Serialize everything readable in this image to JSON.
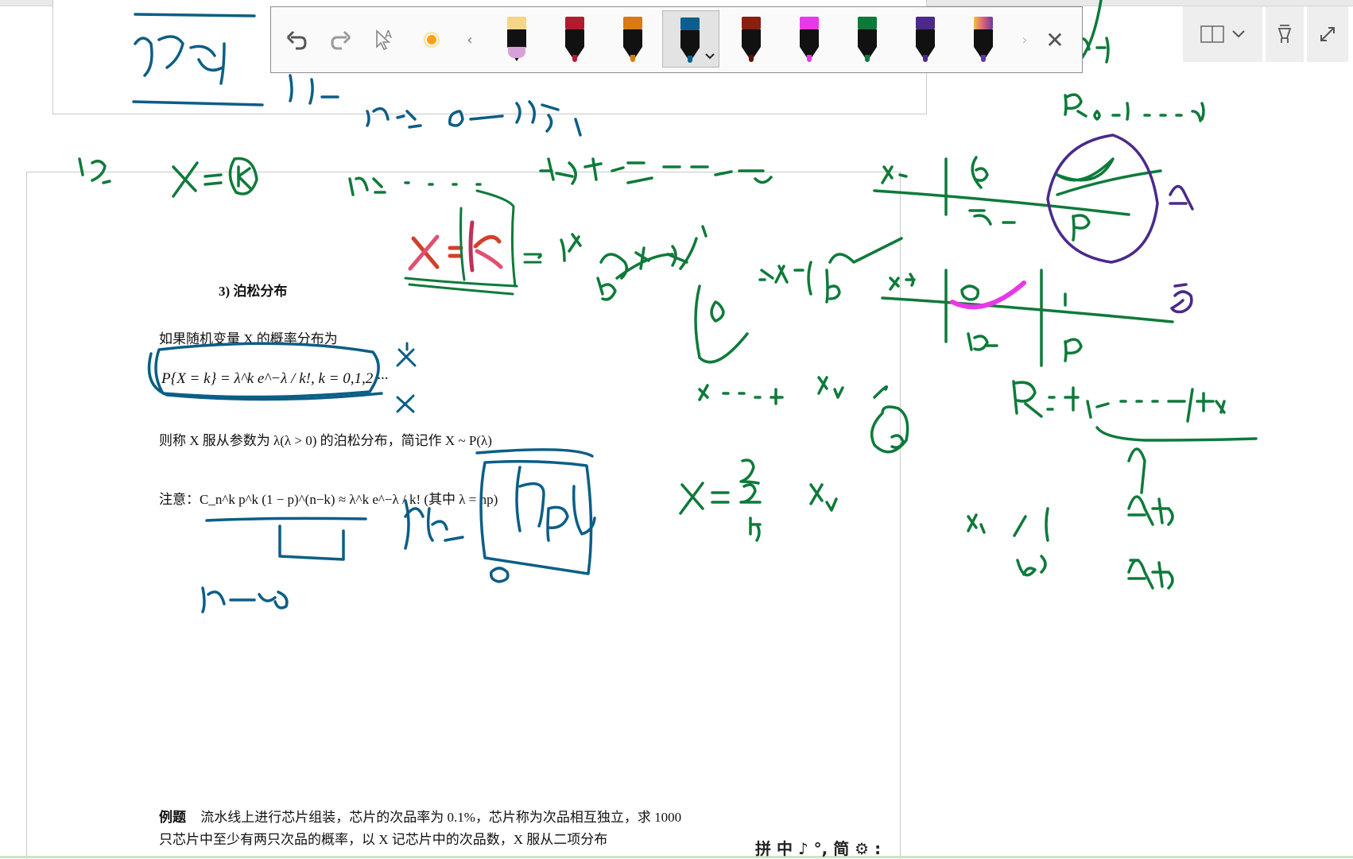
{
  "document": {
    "section_heading": "3)    泊松分布",
    "definition_intro": "如果随机变量 X 的概率分布为",
    "pmf_formula": "P{X = k} = λ^k e^−λ / k!, k = 0,1,2,···",
    "poisson_def": "则称 X 服从参数为 λ(λ > 0) 的泊松分布，简记作 X ~  P(λ)",
    "note": "注意：C_n^k p^k (1 − p)^(n−k) ≈ λ^k e^−λ / k! (其中 λ = np)",
    "example_label": "例题",
    "example_line1": "流水线上进行芯片组装，芯片的次品率为 0.1%，芯片称为次品相互独立，求 1000",
    "example_line2": "只芯片中至少有两只次品的概率，以 X 记芯片中的次品数，X 服从二项分布"
  },
  "ink_toolbar": {
    "undo_icon": "undo-icon",
    "redo_icon": "redo-icon",
    "ink_to_text_icon": "ink-to-text-icon",
    "highlighter_icon": "highlighter-icon",
    "scroll_left": "‹",
    "scroll_right": "›",
    "close": "✕",
    "pens": [
      {
        "name": "pen-pink",
        "cap": "#f5d58a",
        "nib": "#d8a0d8"
      },
      {
        "name": "pen-crimson",
        "cap": "#b01c2e",
        "nib": "#b01c2e"
      },
      {
        "name": "pen-orange",
        "cap": "#d97a12",
        "nib": "#d97a12"
      },
      {
        "name": "pen-teal",
        "cap": "#0a5f8c",
        "nib": "#0a5f8c",
        "selected": true
      },
      {
        "name": "pen-galaxy-red",
        "cap": "#8a2010",
        "nib": "#5a1408"
      },
      {
        "name": "pen-magenta",
        "cap": "#e838e8",
        "nib": "#e838e8"
      },
      {
        "name": "pen-green",
        "cap": "#0e7a3a",
        "nib": "#0e7a3a"
      },
      {
        "name": "pen-purple",
        "cap": "#4b2a8a",
        "nib": "#4b2a8a"
      },
      {
        "name": "pen-rainbow",
        "cap": "#d8607a",
        "nib": "#5a3aa0"
      }
    ]
  },
  "window_controls": {
    "view_icon": "page-view-icon",
    "dropdown_icon": "chevron-down-icon",
    "pen_mode_icon": "pen-mode-icon",
    "fullscreen_icon": "expand-icon"
  },
  "ime_bar": {
    "text": "拼 中 ♪ °, 简 ⚙ :"
  },
  "colors": {
    "ink_blue": "#0b5e86",
    "ink_green": "#0e7a3a",
    "ink_purple": "#4b2a8a",
    "ink_magenta": "#e838e8",
    "ink_red": "#d2402a"
  }
}
